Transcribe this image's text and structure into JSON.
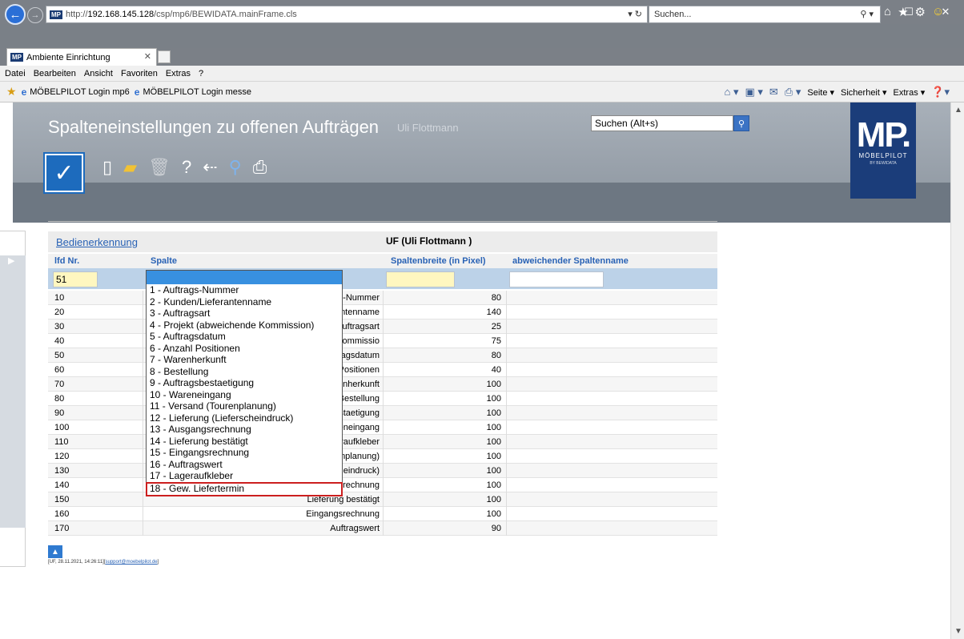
{
  "browser": {
    "url_prefix": "http://",
    "url_host": "192.168.145.128",
    "url_path": "/csp/mp6/BEWIDATA.mainFrame.cls",
    "search_placeholder": "Suchen...",
    "tab_title": "Ambiente Einrichtung",
    "menu": [
      "Datei",
      "Bearbeiten",
      "Ansicht",
      "Favoriten",
      "Extras",
      "?"
    ],
    "favorites": [
      "MÖBELPILOT Login mp6",
      "MÖBELPILOT Login messe"
    ],
    "commands": [
      "Seite ▾",
      "Sicherheit ▾",
      "Extras ▾"
    ]
  },
  "header": {
    "title": "Spalteneinstellungen zu offenen Aufträgen",
    "user": "Uli Flottmann",
    "search_value": "Suchen (Alt+s)",
    "logo_big": "MP.",
    "logo_small": "MÖBELPILOT",
    "logo_tiny": "BY BEWIDATA"
  },
  "panel": {
    "link": "Bedienerkennung",
    "user_code": "UF (Uli Flottmann )",
    "col_nr": "lfd Nr.",
    "col_spalte": "Spalte",
    "col_width": "Spaltenbreite (in Pixel)",
    "col_name": "abweichender Spaltenname",
    "input_nr": "51"
  },
  "rows": [
    {
      "nr": "10",
      "spalte": "Auftrags-Nummer",
      "width": "80"
    },
    {
      "nr": "20",
      "spalte": "Kunden/Lieferantenname",
      "width": "140"
    },
    {
      "nr": "30",
      "spalte": "Auftragsart",
      "width": "25"
    },
    {
      "nr": "40",
      "spalte": "Projekt (abweichende Kommissio",
      "width": "75"
    },
    {
      "nr": "50",
      "spalte": "Auftragsdatum",
      "width": "80"
    },
    {
      "nr": "60",
      "spalte": "Anzahl Positionen",
      "width": "40"
    },
    {
      "nr": "70",
      "spalte": "Warenherkunft",
      "width": "100"
    },
    {
      "nr": "80",
      "spalte": "Bestellung",
      "width": "100"
    },
    {
      "nr": "90",
      "spalte": "Auftragsbestaetigung",
      "width": "100"
    },
    {
      "nr": "100",
      "spalte": "Wareneingang",
      "width": "100"
    },
    {
      "nr": "110",
      "spalte": "Lageraufkleber",
      "width": "100"
    },
    {
      "nr": "120",
      "spalte": "Versand (Tourenplanung)",
      "width": "100"
    },
    {
      "nr": "130",
      "spalte": "Lieferung (Lieferscheindruck)",
      "width": "100"
    },
    {
      "nr": "140",
      "spalte": "Ausgangsrechnung",
      "width": "100"
    },
    {
      "nr": "150",
      "spalte": "Lieferung bestätigt",
      "width": "100"
    },
    {
      "nr": "160",
      "spalte": "Eingangsrechnung",
      "width": "100"
    },
    {
      "nr": "170",
      "spalte": "Auftragswert",
      "width": "90"
    }
  ],
  "dropdown": [
    "1 - Auftrags-Nummer",
    "2 - Kunden/Lieferantenname",
    "3 - Auftragsart",
    "4 - Projekt (abweichende Kommission)",
    "5 - Auftragsdatum",
    "6 - Anzahl Positionen",
    "7 - Warenherkunft",
    "8 - Bestellung",
    "9 - Auftragsbestaetigung",
    "10 - Wareneingang",
    "11 - Versand (Tourenplanung)",
    "12 - Lieferung (Lieferscheindruck)",
    "13 - Ausgangsrechnung",
    "14 - Lieferung bestätigt",
    "15 - Eingangsrechnung",
    "16 - Auftragswert",
    "17 - Lageraufkleber",
    "18 - Gew. Liefertermin"
  ],
  "footer": {
    "info": "[UF, 28.11.2021, 14:26:11][",
    "mail": "support@moebelpilot.de",
    "end": "]"
  },
  "colors": {
    "accent": "#1d6bbd",
    "highlight_outline": "#cc1f1f",
    "logo_bg": "#1b3d7a"
  }
}
